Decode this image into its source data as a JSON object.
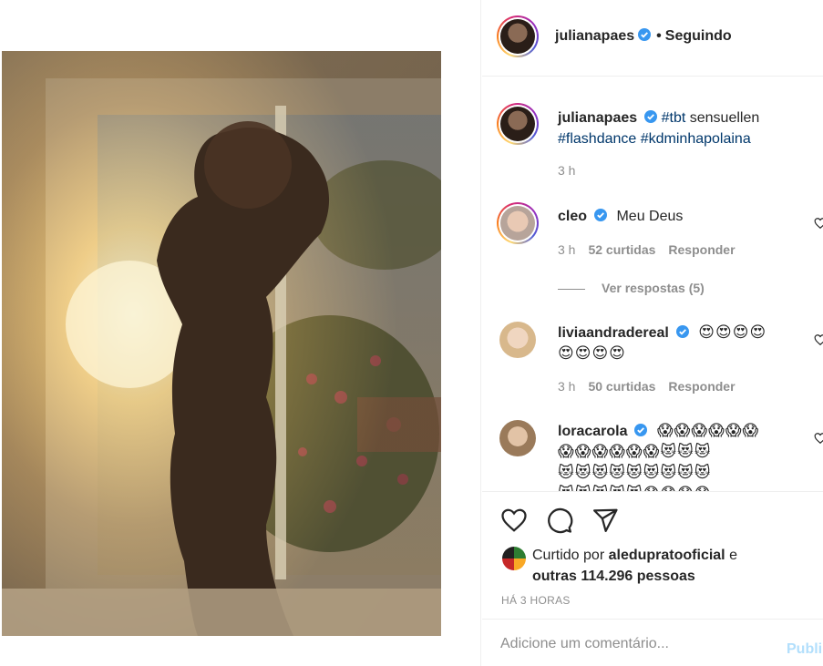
{
  "post": {
    "author": "julianapaes",
    "follow_dot": "•",
    "follow_label": "Seguindo"
  },
  "caption": {
    "user": "julianapaes",
    "tag1": "#tbt",
    "text1": " sensuellen",
    "tag2": "#flashdance",
    "tag3": "#kdminhapolaina",
    "time": "3 h"
  },
  "comments": [
    {
      "user": "cleo",
      "text": "Meu Deus",
      "time": "3 h",
      "likes": "52 curtidas",
      "reply": "Responder",
      "view_replies": "Ver respostas (5)"
    },
    {
      "user": "liviaandradereal",
      "emoji1": "😍😍😍😍",
      "emoji2": "😍😍😍😍",
      "time": "3 h",
      "likes": "50 curtidas",
      "reply": "Responder"
    },
    {
      "user": "loracarola",
      "emoji1": "😱😱😱😱😱😱",
      "emoji2": "😱😱😱😱😱😱😻😻😻",
      "emoji3": "😻😻😻😻😻😻😻😻😻",
      "emoji4": "😻😻😻😻😻😱😱😱😱"
    }
  ],
  "likes": {
    "prefix": "Curtido por ",
    "user": "aleduprato",
    "user_suffix": "oficial",
    "connector": " e",
    "others": "outras 114.296 pessoas"
  },
  "age": "HÁ 3 HORAS",
  "add_comment": {
    "placeholder": "Adicione um comentário...",
    "publish": "Publi"
  },
  "colors": {
    "link": "#00376b",
    "muted": "#8e8e8e",
    "verified": "#3897f0",
    "publish_disabled": "#b2dffc"
  },
  "icons": [
    "heart-icon",
    "comment-icon",
    "share-icon",
    "verified-icon"
  ]
}
